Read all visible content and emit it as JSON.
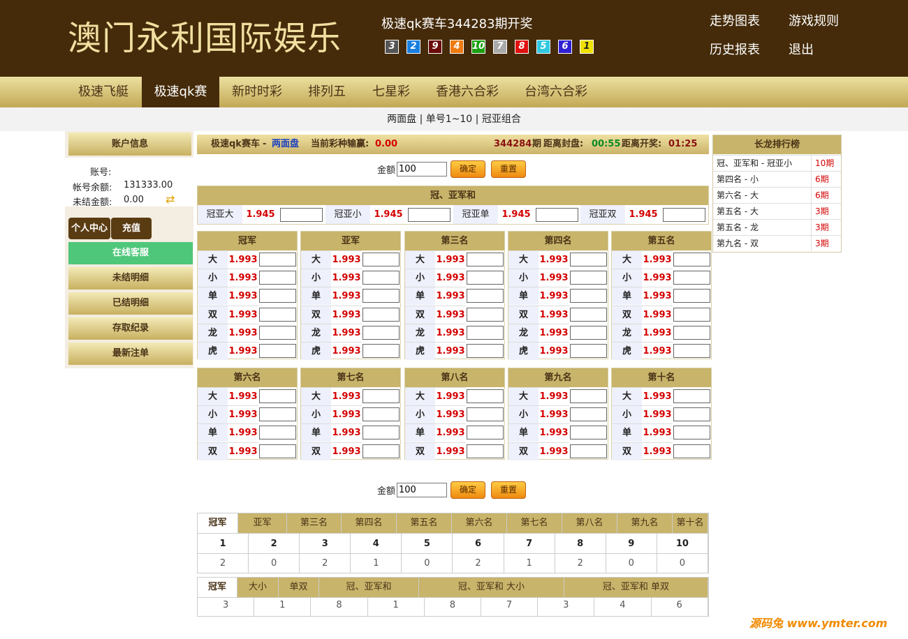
{
  "header": {
    "logo": "澳门永利国际娱乐",
    "draw_title": "极速qk赛车344283期开奖",
    "balls": [
      {
        "num": "3",
        "color": "#555555"
      },
      {
        "num": "2",
        "color": "#1a7fe0"
      },
      {
        "num": "9",
        "color": "#6a0a0a"
      },
      {
        "num": "4",
        "color": "#ee7a10"
      },
      {
        "num": "10",
        "color": "#1aa010"
      },
      {
        "num": "7",
        "color": "#aaaaaa"
      },
      {
        "num": "8",
        "color": "#e01010"
      },
      {
        "num": "5",
        "color": "#30c8e0"
      },
      {
        "num": "6",
        "color": "#3020d0"
      },
      {
        "num": "1",
        "color": "#f0e000"
      }
    ],
    "links": [
      "走势图表",
      "游戏规则",
      "历史报表",
      "退出"
    ]
  },
  "nav": {
    "items": [
      "极速飞艇",
      "极速qk赛",
      "新时时彩",
      "排列五",
      "七星彩",
      "香港六合彩",
      "台湾六合彩"
    ],
    "active": "极速qk赛"
  },
  "subnav": {
    "items": [
      "两面盘",
      "单号1~10",
      "冠亚组合"
    ],
    "sep": "|"
  },
  "sidebar": {
    "title": "账户信息",
    "account_label": "账号:",
    "account_value": "",
    "balance_label": "帐号余额:",
    "balance_value": "131333.00",
    "unsettled_label": "未结金额:",
    "unsettled_value": "0.00",
    "tab_personal": "个人中心",
    "tab_recharge": "充值",
    "online_service": "在线客服",
    "menu": [
      "未结明细",
      "已结明细",
      "存取纪录",
      "最新注单"
    ]
  },
  "topbar": {
    "game": "极速qk赛车",
    "dash": "-",
    "mode": "两面盘",
    "winloss_label": "当前彩种输赢:",
    "winloss_value": "0.00",
    "period": "344284",
    "period_unit": "期",
    "close_label": "距离封盘:",
    "close_time": "00:55",
    "open_label": "距离开奖:",
    "open_time": "01:25"
  },
  "amount": {
    "label": "金额",
    "value": "100",
    "confirm": "确定",
    "reset": "重置"
  },
  "combo": {
    "title": "冠、亚军和",
    "items": [
      {
        "label": "冠亚大",
        "odds": "1.945"
      },
      {
        "label": "冠亚小",
        "odds": "1.945"
      },
      {
        "label": "冠亚单",
        "odds": "1.945"
      },
      {
        "label": "冠亚双",
        "odds": "1.945"
      }
    ]
  },
  "positions_top": [
    {
      "title": "冠军",
      "rows": [
        [
          "大",
          "1.993"
        ],
        [
          "小",
          "1.993"
        ],
        [
          "单",
          "1.993"
        ],
        [
          "双",
          "1.993"
        ],
        [
          "龙",
          "1.993"
        ],
        [
          "虎",
          "1.993"
        ]
      ]
    },
    {
      "title": "亚军",
      "rows": [
        [
          "大",
          "1.993"
        ],
        [
          "小",
          "1.993"
        ],
        [
          "单",
          "1.993"
        ],
        [
          "双",
          "1.993"
        ],
        [
          "龙",
          "1.993"
        ],
        [
          "虎",
          "1.993"
        ]
      ]
    },
    {
      "title": "第三名",
      "rows": [
        [
          "大",
          "1.993"
        ],
        [
          "小",
          "1.993"
        ],
        [
          "单",
          "1.993"
        ],
        [
          "双",
          "1.993"
        ],
        [
          "龙",
          "1.993"
        ],
        [
          "虎",
          "1.993"
        ]
      ]
    },
    {
      "title": "第四名",
      "rows": [
        [
          "大",
          "1.993"
        ],
        [
          "小",
          "1.993"
        ],
        [
          "单",
          "1.993"
        ],
        [
          "双",
          "1.993"
        ],
        [
          "龙",
          "1.993"
        ],
        [
          "虎",
          "1.993"
        ]
      ]
    },
    {
      "title": "第五名",
      "rows": [
        [
          "大",
          "1.993"
        ],
        [
          "小",
          "1.993"
        ],
        [
          "单",
          "1.993"
        ],
        [
          "双",
          "1.993"
        ],
        [
          "龙",
          "1.993"
        ],
        [
          "虎",
          "1.993"
        ]
      ]
    }
  ],
  "positions_bottom": [
    {
      "title": "第六名",
      "rows": [
        [
          "大",
          "1.993"
        ],
        [
          "小",
          "1.993"
        ],
        [
          "单",
          "1.993"
        ],
        [
          "双",
          "1.993"
        ]
      ]
    },
    {
      "title": "第七名",
      "rows": [
        [
          "大",
          "1.993"
        ],
        [
          "小",
          "1.993"
        ],
        [
          "单",
          "1.993"
        ],
        [
          "双",
          "1.993"
        ]
      ]
    },
    {
      "title": "第八名",
      "rows": [
        [
          "大",
          "1.993"
        ],
        [
          "小",
          "1.993"
        ],
        [
          "单",
          "1.993"
        ],
        [
          "双",
          "1.993"
        ]
      ]
    },
    {
      "title": "第九名",
      "rows": [
        [
          "大",
          "1.993"
        ],
        [
          "小",
          "1.993"
        ],
        [
          "单",
          "1.993"
        ],
        [
          "双",
          "1.993"
        ]
      ]
    },
    {
      "title": "第十名",
      "rows": [
        [
          "大",
          "1.993"
        ],
        [
          "小",
          "1.993"
        ],
        [
          "单",
          "1.993"
        ],
        [
          "双",
          "1.993"
        ]
      ]
    }
  ],
  "long_dragon": {
    "title": "长龙排行榜",
    "rows": [
      {
        "name": "冠、亚军和 - 冠亚小",
        "periods": "10期"
      },
      {
        "name": "第四名 - 小",
        "periods": "6期"
      },
      {
        "name": "第六名 - 大",
        "periods": "6期"
      },
      {
        "name": "第五名 - 大",
        "periods": "3期"
      },
      {
        "name": "第五名 - 龙",
        "periods": "3期"
      },
      {
        "name": "第九名 - 双",
        "periods": "3期"
      }
    ]
  },
  "stats1": {
    "tabs": [
      "冠军",
      "亚军",
      "第三名",
      "第四名",
      "第五名",
      "第六名",
      "第七名",
      "第八名",
      "第九名",
      "第十名"
    ],
    "numbers": [
      "1",
      "2",
      "3",
      "4",
      "5",
      "6",
      "7",
      "8",
      "9",
      "10"
    ],
    "counts": [
      "2",
      "0",
      "2",
      "1",
      "0",
      "2",
      "1",
      "2",
      "0",
      "0"
    ]
  },
  "stats2": {
    "tabs": [
      "冠军",
      "大小",
      "单双",
      "冠、亚军和",
      "冠、亚军和 大小",
      "冠、亚军和 单双"
    ],
    "values": [
      "3",
      "1",
      "8",
      "1",
      "8",
      "7",
      "3",
      "4",
      "6"
    ]
  },
  "watermark": "源码兔 www.ymter.com"
}
